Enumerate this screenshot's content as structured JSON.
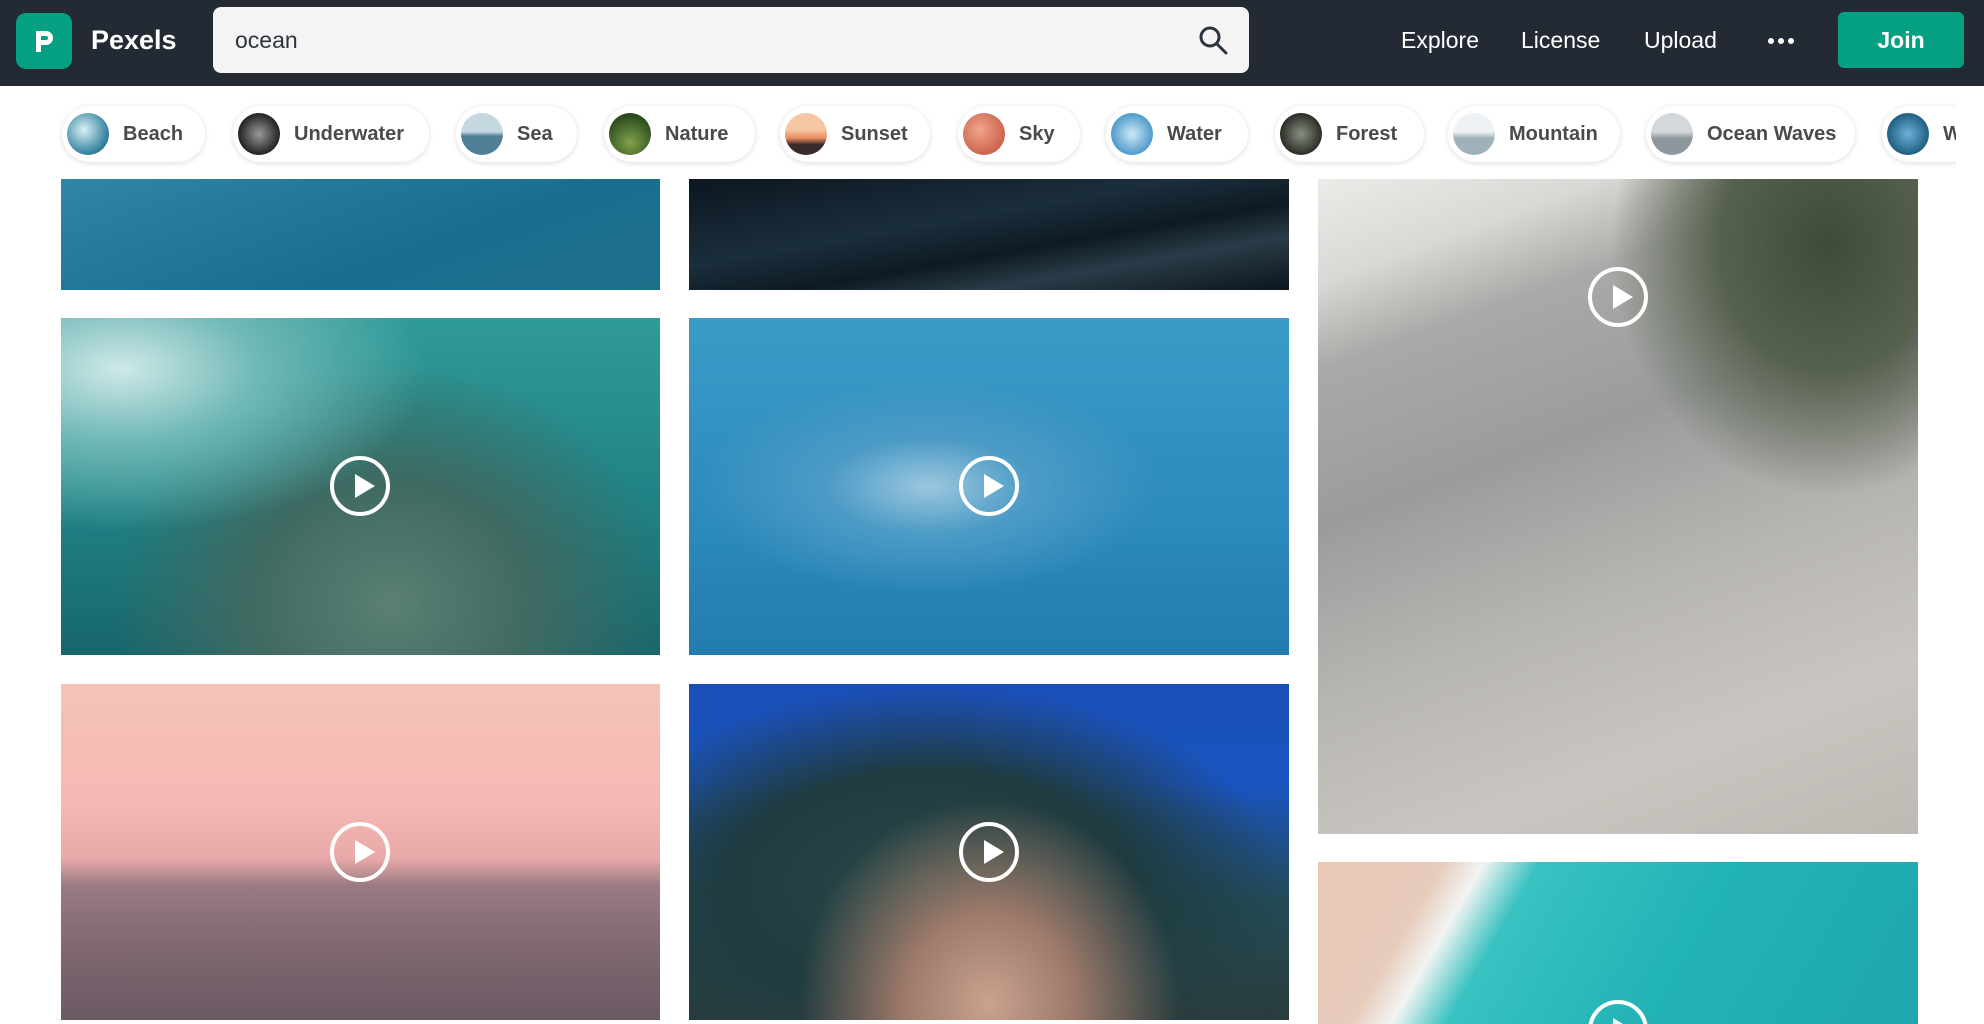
{
  "header": {
    "brand": "Pexels",
    "search_value": "ocean",
    "nav": [
      "Explore",
      "License",
      "Upload"
    ],
    "join_label": "Join"
  },
  "chips": [
    {
      "label": "Beach",
      "color": "#2f7f9c"
    },
    {
      "label": "Underwater",
      "color": "#3b3b3b"
    },
    {
      "label": "Sea",
      "color": "#6c94a8"
    },
    {
      "label": "Nature",
      "color": "#3f6b2a"
    },
    {
      "label": "Sunset",
      "color": "#e88a5e"
    },
    {
      "label": "Sky",
      "color": "#d77a60"
    },
    {
      "label": "Water",
      "color": "#4f9bcb"
    },
    {
      "label": "Forest",
      "color": "#4a5044"
    },
    {
      "label": "Mountain",
      "color": "#9fb2bb"
    },
    {
      "label": "Ocean Waves",
      "color": "#8e979b"
    },
    {
      "label": "W",
      "color": "#1f5f84"
    }
  ],
  "colors": {
    "header_bg": "#232a34",
    "accent": "#05a081"
  },
  "icons": {
    "logo": "pexels-logo-icon",
    "search": "search-icon",
    "more": "more-dots-icon",
    "play": "play-icon"
  }
}
